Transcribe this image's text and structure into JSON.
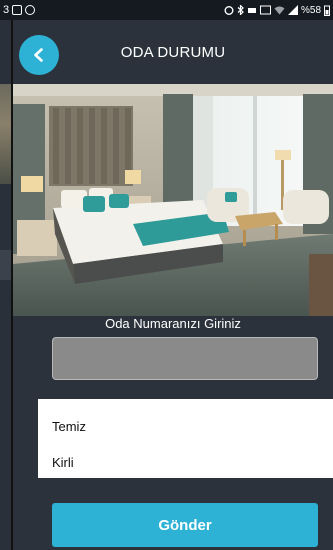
{
  "status_bar": {
    "left_text": "3",
    "battery_text": "%58"
  },
  "header": {
    "title": "ODA DURUMU"
  },
  "form": {
    "room_label": "Oda Numaranızı Giriniz",
    "room_input_value": "",
    "room_input_placeholder": ""
  },
  "options": [
    {
      "label": "Temiz"
    },
    {
      "label": "Kirli"
    }
  ],
  "submit_label": "Gönder",
  "colors": {
    "accent": "#2db2d5",
    "background": "#2b323b"
  }
}
